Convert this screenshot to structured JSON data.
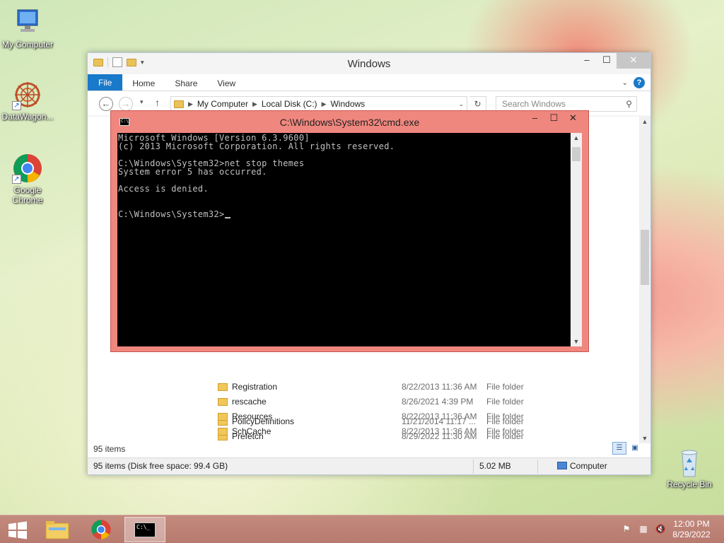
{
  "desktop": {
    "icons": [
      {
        "label": "My Computer"
      },
      {
        "label": "DataWagon..."
      },
      {
        "label": "Google Chrome"
      },
      {
        "label": "Recycle Bin"
      }
    ]
  },
  "explorer": {
    "title": "Windows",
    "ribbon": {
      "file": "File",
      "home": "Home",
      "share": "Share",
      "view": "View"
    },
    "address": {
      "crumbs": [
        "My Computer",
        "Local Disk (C:)",
        "Windows"
      ]
    },
    "search_placeholder": "Search Windows",
    "rows": [
      {
        "name": "PolicyDefinitions",
        "date": "11/21/2014 11:17 ...",
        "type": "File folder"
      },
      {
        "name": "Prefetch",
        "date": "8/29/2022 11:30 AM",
        "type": "File folder"
      },
      {
        "name": "Registration",
        "date": "8/22/2013 11:36 AM",
        "type": "File folder"
      },
      {
        "name": "rescache",
        "date": "8/26/2021 4:39 PM",
        "type": "File folder"
      },
      {
        "name": "Resources",
        "date": "8/22/2013 11:36 AM",
        "type": "File folder"
      },
      {
        "name": "SchCache",
        "date": "8/22/2013 11:36 AM",
        "type": "File folder"
      }
    ],
    "item_count": "95 items",
    "status": {
      "summary": "95 items (Disk free space: 99.4 GB)",
      "size": "5.02 MB",
      "location": "Computer"
    }
  },
  "cmd": {
    "title": "C:\\Windows\\System32\\cmd.exe",
    "lines": [
      "Microsoft Windows [Version 6.3.9600]",
      "(c) 2013 Microsoft Corporation. All rights reserved.",
      "",
      "C:\\Windows\\System32>net stop themes",
      "System error 5 has occurred.",
      "",
      "Access is denied.",
      "",
      "",
      "C:\\Windows\\System32>"
    ]
  },
  "taskbar": {
    "time": "12:00 PM",
    "date": "8/29/2022"
  }
}
